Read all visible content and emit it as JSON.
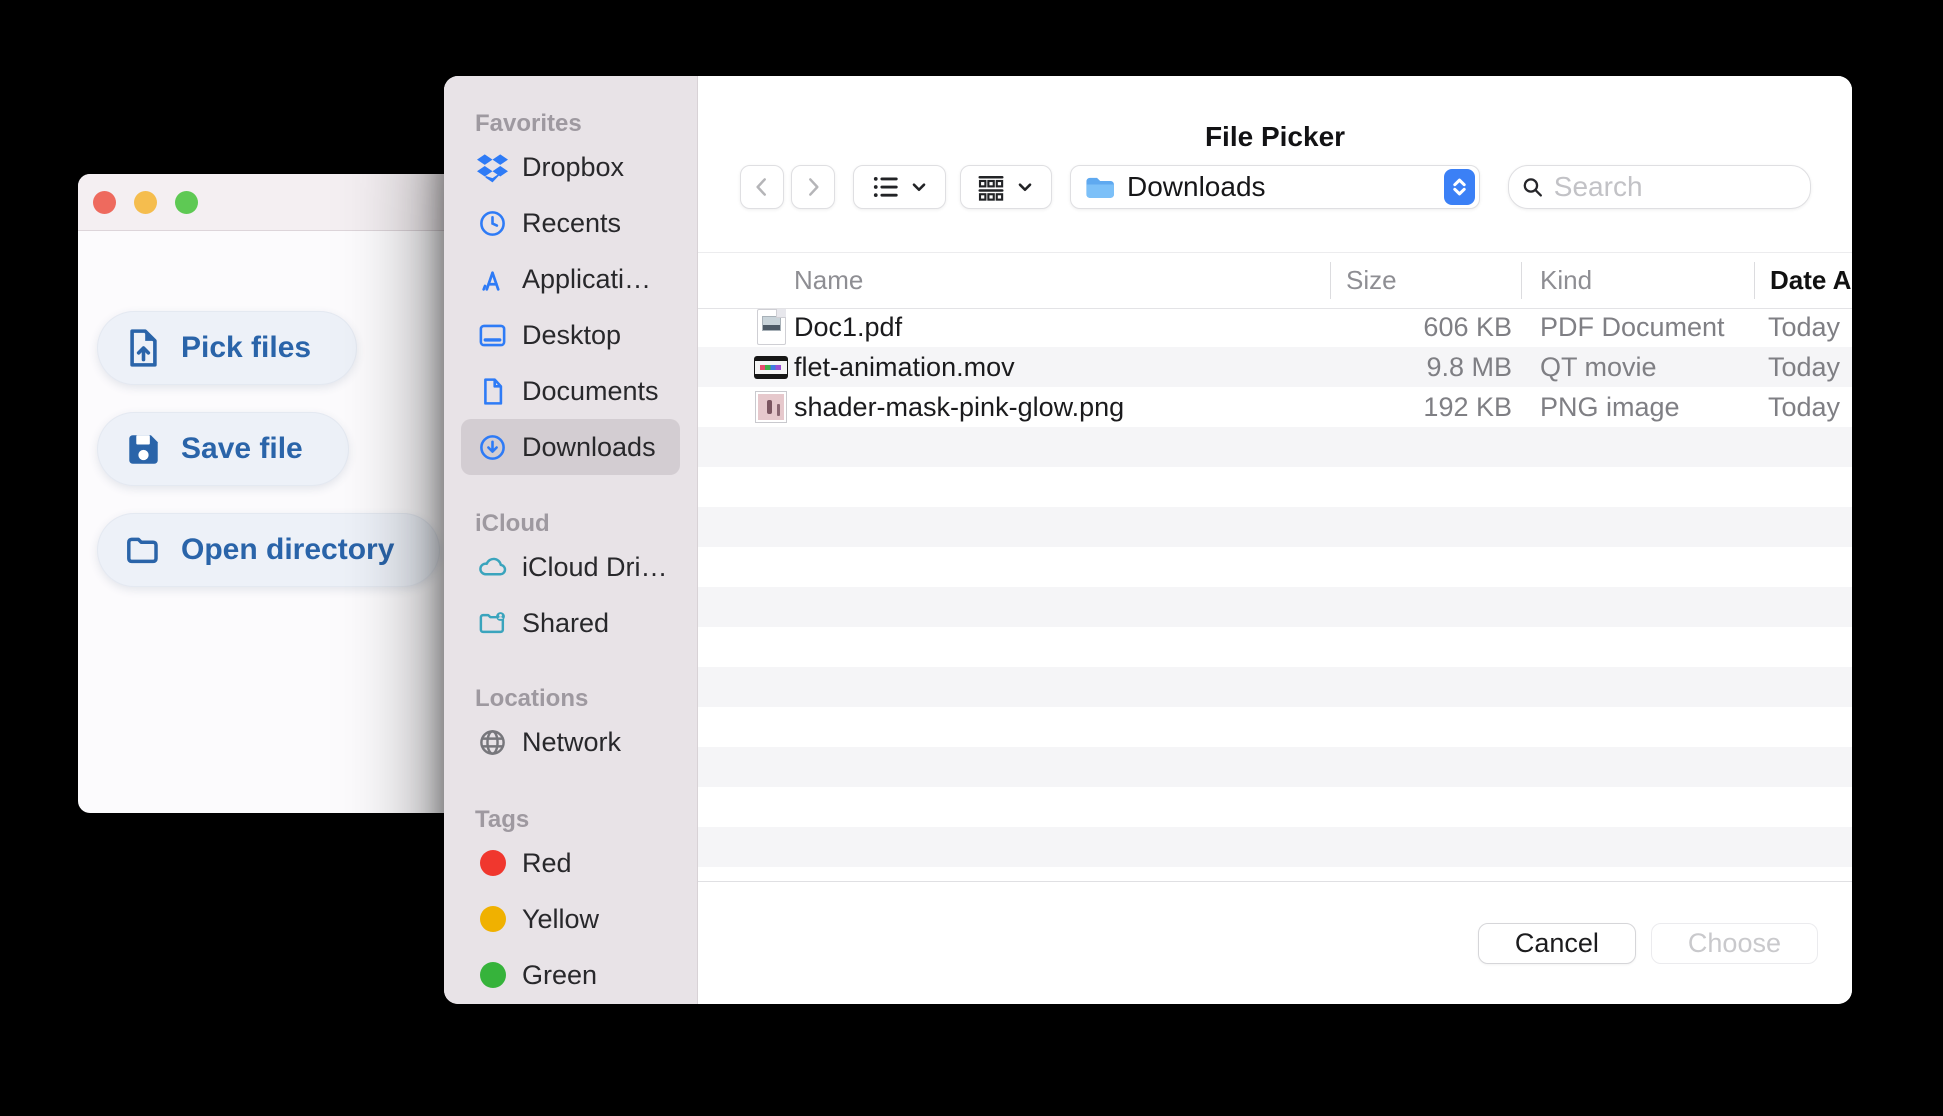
{
  "colors": {
    "background": "#000000",
    "accent_blue": "#2a64a9",
    "sidebar_icon_blue": "#2e7bf6",
    "icloud_teal": "#3aa4bd",
    "stepper_blue": "#3b80f6",
    "traffic_close": "#ee6a5e",
    "traffic_minimize": "#f5bd4e",
    "traffic_zoom": "#5ec954",
    "tag_red": "#f0372e",
    "tag_yellow": "#f0b100",
    "tag_green": "#36b33b"
  },
  "app_window": {
    "buttons": [
      {
        "label": "Pick files",
        "icon": "file-upload"
      },
      {
        "label": "Save file",
        "icon": "floppy-save"
      },
      {
        "label": "Open directory",
        "icon": "folder-open"
      }
    ]
  },
  "file_picker": {
    "title": "File Picker",
    "toolbar": {
      "location": {
        "label": "Downloads",
        "icon": "folder-blue"
      },
      "search": {
        "placeholder": "Search"
      }
    },
    "sidebar": {
      "sections": [
        {
          "header": "Favorites",
          "items": [
            {
              "label": "Dropbox",
              "icon": "dropbox",
              "color": "#2e7bf6",
              "selected": false
            },
            {
              "label": "Recents",
              "icon": "clock",
              "color": "#2e7bf6",
              "selected": false
            },
            {
              "label": "Applicati…",
              "icon": "appstore",
              "color": "#2e7bf6",
              "selected": false
            },
            {
              "label": "Desktop",
              "icon": "desktop",
              "color": "#2e7bf6",
              "selected": false
            },
            {
              "label": "Documents",
              "icon": "document",
              "color": "#2e7bf6",
              "selected": false
            },
            {
              "label": "Downloads",
              "icon": "download-circle",
              "color": "#2e7bf6",
              "selected": true
            }
          ]
        },
        {
          "header": "iCloud",
          "items": [
            {
              "label": "iCloud Dri…",
              "icon": "cloud",
              "color": "#3aa4bd",
              "selected": false
            },
            {
              "label": "Shared",
              "icon": "shared-folder",
              "color": "#3aa4bd",
              "selected": false
            }
          ]
        },
        {
          "header": "Locations",
          "items": [
            {
              "label": "Network",
              "icon": "globe",
              "color": "#77777c",
              "selected": false
            }
          ]
        },
        {
          "header": "Tags",
          "items": [
            {
              "label": "Red",
              "icon": "dot",
              "color": "#f0372e",
              "selected": false
            },
            {
              "label": "Yellow",
              "icon": "dot",
              "color": "#f0b100",
              "selected": false
            },
            {
              "label": "Green",
              "icon": "dot",
              "color": "#36b33b",
              "selected": false
            }
          ]
        }
      ]
    },
    "table": {
      "columns": [
        "Name",
        "Size",
        "Kind",
        "Date Added"
      ],
      "sorted_column": "Date Added",
      "rows": [
        {
          "name": "Doc1.pdf",
          "size": "606 KB",
          "kind": "PDF Document",
          "date_added": "Today",
          "icon": "pdf-file"
        },
        {
          "name": "flet-animation.mov",
          "size": "9.8 MB",
          "kind": "QT movie",
          "date_added": "Today",
          "icon": "mov-file"
        },
        {
          "name": "shader-mask-pink-glow.png",
          "size": "192 KB",
          "kind": "PNG image",
          "date_added": "Today",
          "icon": "png-file"
        }
      ]
    },
    "footer": {
      "cancel_label": "Cancel",
      "choose_label": "Choose",
      "choose_enabled": false
    }
  }
}
